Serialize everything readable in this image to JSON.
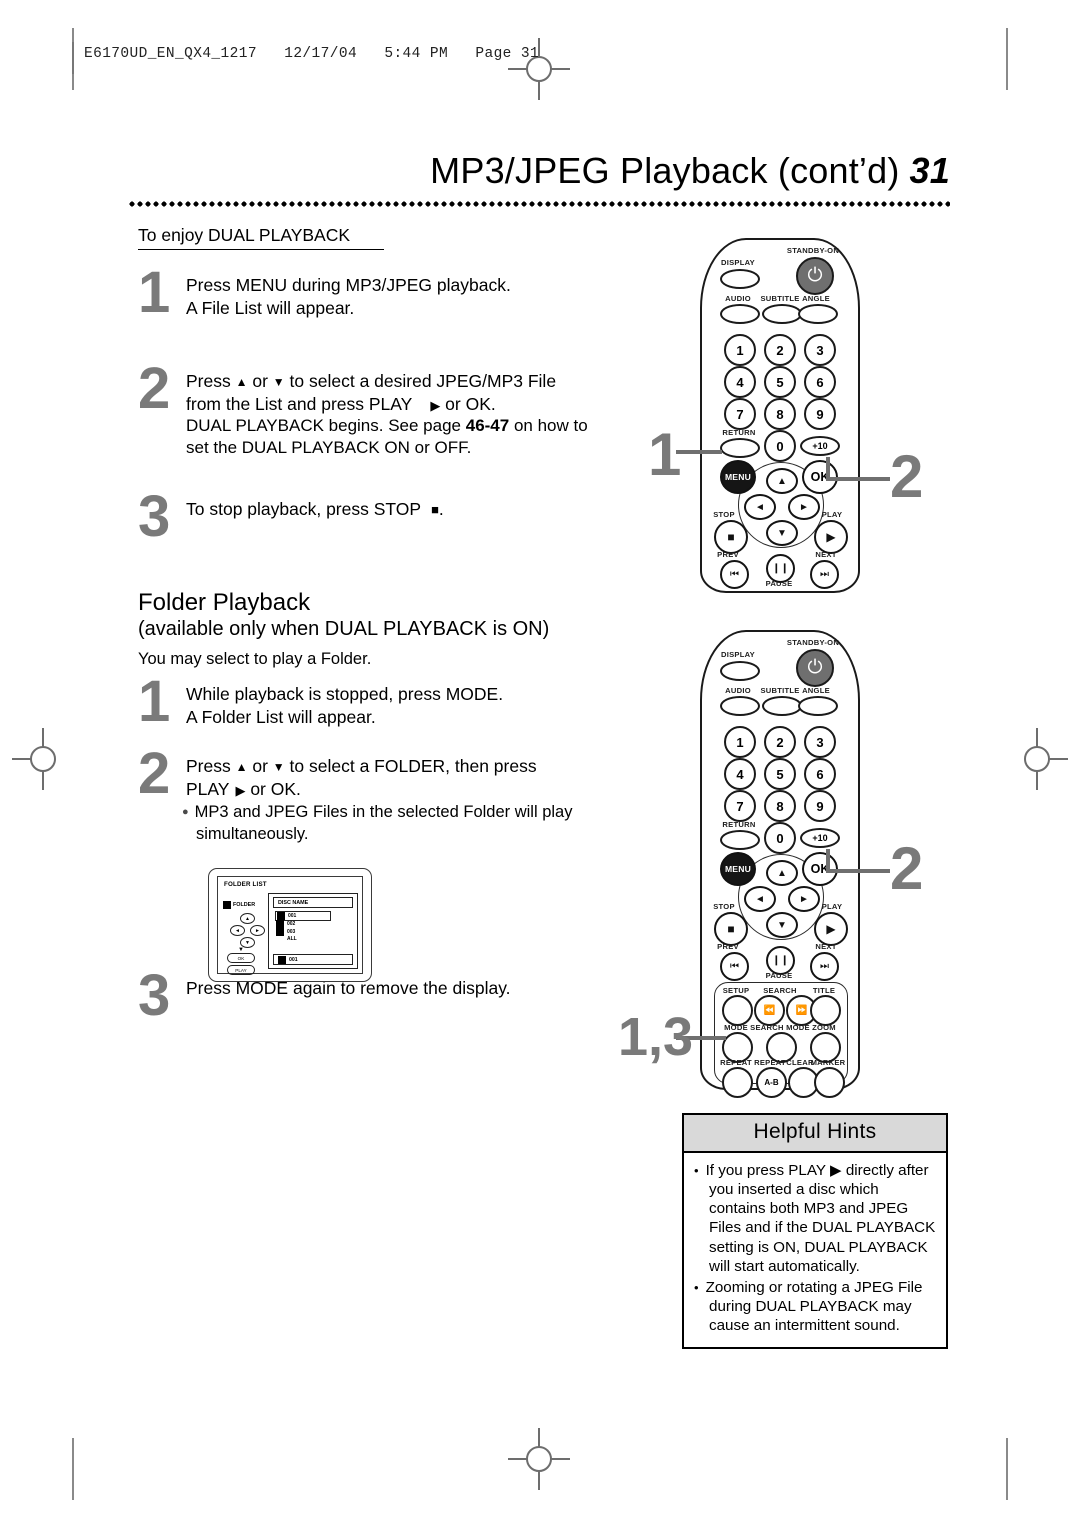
{
  "print_slug": "E6170UD_EN_QX4_1217   12/17/04   5:44 PM   Page 31",
  "title": {
    "text": "MP3/JPEG  Playback (cont’d)",
    "page_number": "31"
  },
  "section_dual": {
    "heading": "To  enjoy DUAL PLAYBACK",
    "steps": [
      {
        "number": "1",
        "lines": [
          "Press MENU during MP3/JPEG playback.",
          "A File List will appear."
        ]
      },
      {
        "number": "2",
        "line1_a": "Press ",
        "line1_b": " or ",
        "line1_c": " to select a desired JPEG/MP3 File",
        "line2_a": "from the List and press PLAY",
        "line2_b": " or OK.",
        "line3_a": "DUAL PLAYBACK begins. See page ",
        "line3_pages": "46-47",
        "line3_b": " on how to",
        "line4": "set the DUAL PLAYBACK ON or OFF."
      },
      {
        "number": "3",
        "line1_a": "To  stop playback, press STOP",
        "line1_b": "."
      }
    ]
  },
  "section_folder": {
    "title": "Folder Playback",
    "subtitle": "(available only when DUAL PLAYBACK is ON)",
    "note": "You may select to play a Folder.",
    "steps": [
      {
        "number": "1",
        "lines": [
          "While playback is stopped, press MODE.",
          "A Folder List will appear."
        ]
      },
      {
        "number": "2",
        "line1_a": "Press ",
        "line1_b": " or ",
        "line1_c": " to select a FOLDER, then press",
        "line2_a": "PLAY",
        "line2_b": " or OK.",
        "bullet": "MP3 and JPEG Files in the selected Folder will play simultaneously."
      },
      {
        "number": "3",
        "line1_a": "Press MODE again to remove the display."
      }
    ]
  },
  "osd_screen": {
    "title": "FOLDER LIST",
    "folder_tag": "FOLDER",
    "disc_name": "DISC NAME",
    "items": [
      "001",
      "002",
      "003",
      "ALL"
    ],
    "selected_item": "001",
    "footer_item": "001",
    "ok_button": "OK",
    "play_button": "PLAY"
  },
  "remote": {
    "display": "DISPLAY",
    "standby": "STANDBY-ON",
    "audio": "AUDIO",
    "subtitle": "SUBTITLE",
    "angle": "ANGLE",
    "numbers": [
      "1",
      "2",
      "3",
      "4",
      "5",
      "6",
      "7",
      "8",
      "9"
    ],
    "return": "RETURN",
    "zero": "0",
    "plus_ten": "+10",
    "menu": "MENU",
    "ok": "OK",
    "stop": "STOP",
    "play": "PLAY",
    "prev": "PREV",
    "pause": "PAUSE",
    "next": "NEXT",
    "setup": "SETUP",
    "search": "SEARCH",
    "title_btn": "TITLE",
    "mode": "MODE",
    "search_mode": "SEARCH MODE",
    "zoom": "ZOOM",
    "repeat": "REPEAT",
    "repeat_ab_label": "REPEAT",
    "repeat_ab": "A-B",
    "clear": "CLEAR",
    "marker": "MARKER"
  },
  "callouts": {
    "top_left": "1",
    "top_right": "2",
    "mid_right": "2",
    "bottom_left": "1,3"
  },
  "helpful_hints": {
    "heading": "Helpful Hints",
    "items": [
      "If you press PLAY ▶ directly after you inserted a disc which contains both MP3 and JPEG Files and if the DUAL PLAYBACK setting is ON, DUAL PLAYBACK will start automatically.",
      "Zooming or rotating a JPEG File during DUAL PLAYBACK may cause an intermittent sound."
    ]
  }
}
